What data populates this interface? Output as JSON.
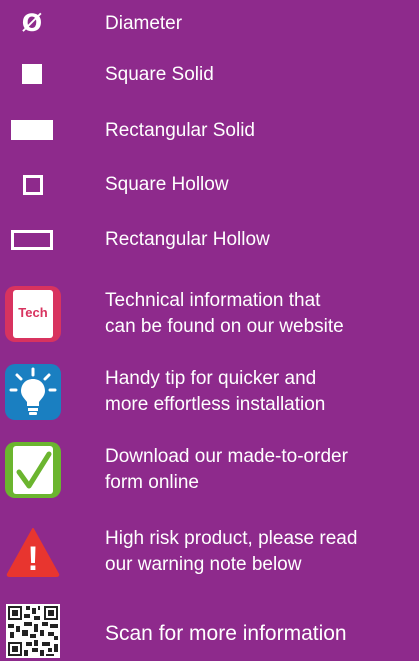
{
  "legend": {
    "diameter": {
      "glyph": "Ø",
      "label": "Diameter"
    },
    "square_solid": {
      "label": "Square Solid"
    },
    "rectangular_solid": {
      "label": "Rectangular Solid"
    },
    "square_hollow": {
      "label": "Square Hollow"
    },
    "rectangular_hollow": {
      "label": "Rectangular Hollow"
    },
    "technical": {
      "badge_text": "Tech",
      "line1": "Technical information that",
      "line2": "can be found on our website"
    },
    "tip": {
      "line1": "Handy tip for quicker and",
      "line2": "more effortless installation"
    },
    "download": {
      "line1": "Download our made-to-order",
      "line2": "form online"
    },
    "warning": {
      "glyph": "!",
      "line1": "High risk product, please read",
      "line2": "our warning note below"
    },
    "scan": {
      "label": "Scan for more information"
    }
  },
  "colors": {
    "background": "#8e2a8c",
    "tech_badge": "#d8335f",
    "tip_badge": "#1a7fc1",
    "download_badge": "#6bb52f",
    "warning_triangle": "#e8352f"
  },
  "icons": [
    "diameter-icon",
    "square-solid-icon",
    "rectangular-solid-icon",
    "square-hollow-icon",
    "rectangular-hollow-icon",
    "tech-icon",
    "lightbulb-icon",
    "checkmark-form-icon",
    "warning-icon",
    "qr-code-icon"
  ]
}
